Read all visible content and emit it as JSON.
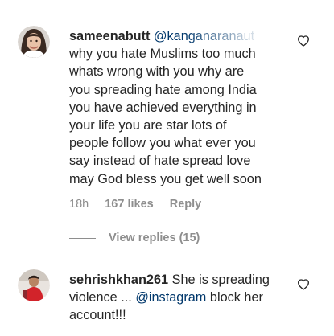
{
  "comments": [
    {
      "username": "sameenabutt",
      "mention": "@kanganaranaut",
      "lines": [
        "why you hate Muslims too much",
        "whats wrong with you why are",
        "you spreading hate among India",
        "you have achieved everything in",
        "your life you are star lots of",
        "people follow you what ever you",
        "say instead of hate spread love",
        "may God bless you get well soon"
      ],
      "time": "18h",
      "likes": "167 likes",
      "reply": "Reply",
      "view_replies": "View replies (15)"
    },
    {
      "username": "sehrishkhan261",
      "line1": "She is spreading",
      "line2a": "violence ... ",
      "mention": "@instagram",
      "line2b": " block her",
      "line3": "account!!!"
    }
  ],
  "colors": {
    "text": "#262626",
    "mention": "#00376b",
    "meta": "#8e8e8e"
  },
  "icons": {
    "like": "heart-outline-icon"
  }
}
